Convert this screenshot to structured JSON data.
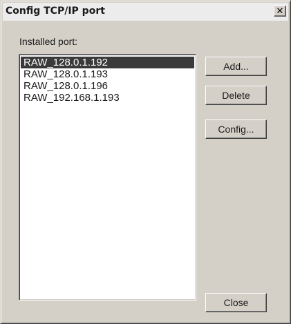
{
  "window": {
    "title": "Config TCP/IP port",
    "close_glyph": "✕"
  },
  "installed_label": "Installed port:",
  "ports": [
    {
      "name": "RAW_128.0.1.192",
      "selected": true
    },
    {
      "name": "RAW_128.0.1.193",
      "selected": false
    },
    {
      "name": "RAW_128.0.1.196",
      "selected": false
    },
    {
      "name": "RAW_192.168.1.193",
      "selected": false
    }
  ],
  "buttons": {
    "add": "Add...",
    "delete": "Delete",
    "config": "Config...",
    "close": "Close"
  },
  "colors": {
    "dialog_face": "#d4d0c8",
    "selection_bg": "#3a3a3a",
    "selection_fg": "#ffffff"
  }
}
